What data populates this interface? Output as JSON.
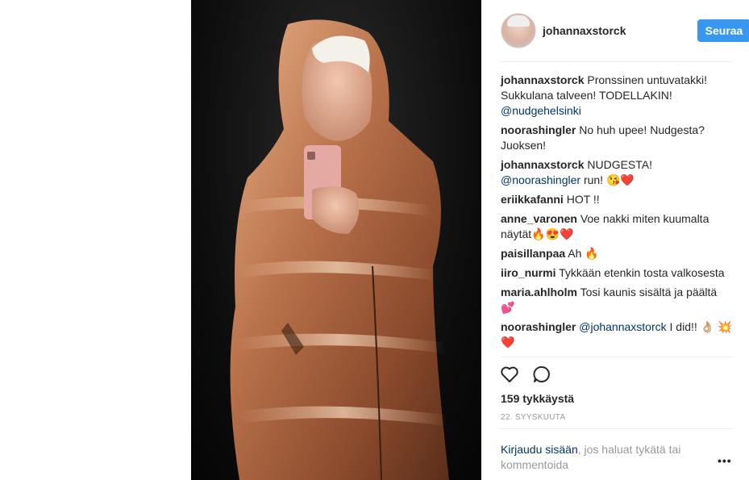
{
  "post": {
    "author": "johannaxstorck",
    "follow_label": "Seuraa"
  },
  "comments": [
    {
      "author": "johannaxstorck",
      "text": "Pronssinen untuvatakki! Sukkulana talveen! TODELLAKIN!",
      "mention": "@nudgehelsinki",
      "after": ""
    },
    {
      "author": "noorashingler",
      "text": "No huh upee! Nudgesta? Juoksen!",
      "mention": "",
      "after": ""
    },
    {
      "author": "johannaxstorck",
      "text": "NUDGESTA!",
      "mention": "@noorashingler",
      "after": "run! 😘❤️"
    },
    {
      "author": "eriikkafanni",
      "text": "HOT !!",
      "mention": "",
      "after": ""
    },
    {
      "author": "anne_varonen",
      "text": "Voe nakki miten kuumalta näytät🔥😍❤️",
      "mention": "",
      "after": ""
    },
    {
      "author": "paisillanpaa",
      "text": "Ah 🔥",
      "mention": "",
      "after": ""
    },
    {
      "author": "iiro_nurmi",
      "text": "Tykkään etenkin tosta valkosesta",
      "mention": "",
      "after": ""
    },
    {
      "author": "maria.ahlholm",
      "text": "Tosi kaunis sisältä ja päältä 💕",
      "mention": "",
      "after": ""
    },
    {
      "author": "noorashingler",
      "text": "",
      "mention": "@johannaxstorck",
      "after": "I did!! 👌🏼 💥❤️"
    }
  ],
  "stats": {
    "likes": "159 tykkäystä",
    "date": "22. syyskuuta"
  },
  "login_prompt": {
    "link": "Kirjaudu sisään",
    "text": ", jos haluat tykätä tai kommentoida"
  },
  "more_label": "•••",
  "icons": {
    "like": "heart-icon",
    "comment": "comment-icon"
  },
  "colors": {
    "accent": "#3897f0",
    "mention": "#003569",
    "muted": "#999999"
  }
}
